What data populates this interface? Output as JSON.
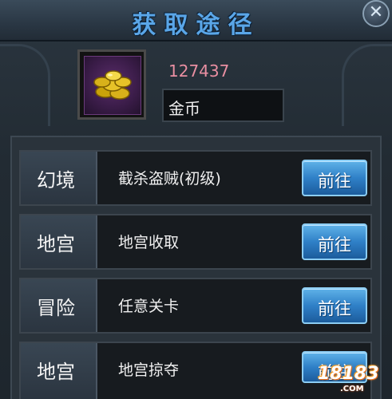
{
  "title": "获取途径",
  "close_glyph": "✕",
  "item": {
    "icon": "gold-coins-icon",
    "count": "127437",
    "name": "金币"
  },
  "sources": [
    {
      "category": "幻境",
      "description": "截杀盗贼(初级)",
      "button": "前往"
    },
    {
      "category": "地宫",
      "description": "地宫收取",
      "button": "前往"
    },
    {
      "category": "冒险",
      "description": "任意关卡",
      "button": "前往"
    },
    {
      "category": "地宫",
      "description": "地宫掠夺",
      "button": "前往"
    }
  ],
  "watermark": {
    "text": "18183",
    "sub": ".COM"
  },
  "colors": {
    "title": "#5aa6e8",
    "count": "#e98fa2",
    "button": "#2f80c7"
  }
}
